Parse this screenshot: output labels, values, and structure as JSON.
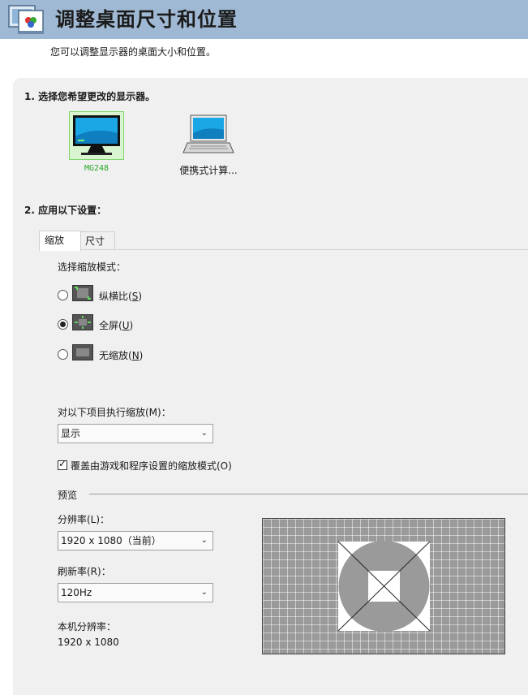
{
  "header": {
    "title": "调整桌面尺寸和位置"
  },
  "subtitle": "您可以调整显示器的桌面大小和位置。",
  "step1": {
    "label": "1.  选择您希望更改的显示器。"
  },
  "displays": [
    {
      "label": "MG248",
      "selected": true
    },
    {
      "label": "便携式计算..."
    }
  ],
  "step2": {
    "label": "2.  应用以下设置："
  },
  "tabs": [
    {
      "label": "缩放",
      "active": true
    },
    {
      "label": "尺寸",
      "active": false
    }
  ],
  "scaling": {
    "mode_title": "选择缩放模式：",
    "options": [
      {
        "text": "纵横比(",
        "key": "S",
        "tail": ")",
        "checked": false
      },
      {
        "text": "全屏(",
        "key": "U",
        "tail": ")",
        "checked": true
      },
      {
        "text": "无缩放(",
        "key": "N",
        "tail": ")",
        "checked": false
      }
    ],
    "perform_label": "对以下项目执行缩放(M)：",
    "perform_value": "显示",
    "override_label": "覆盖由游戏和程序设置的缩放模式(O)",
    "override_checked": true
  },
  "preview": {
    "section_label": "预览",
    "resolution_label": "分辨率(L)：",
    "resolution_value": "1920 x 1080（当前）",
    "refresh_label": "刷新率(R)：",
    "refresh_value": "120Hz",
    "native_label": "本机分辨率：",
    "native_value": "1920 x 1080"
  },
  "colors": {
    "header_bg": "#9fb8d3",
    "panel_bg": "#f0f0f0",
    "accent_green": "#2aa82a"
  }
}
